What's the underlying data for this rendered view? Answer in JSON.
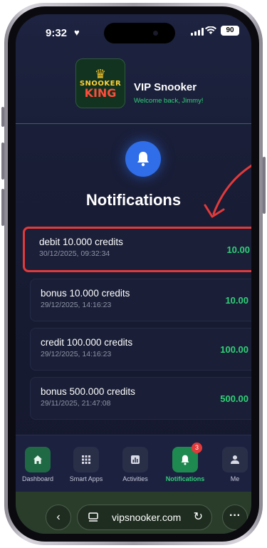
{
  "status": {
    "time": "9:32",
    "battery": "90"
  },
  "header": {
    "app_name": "VIP Snooker",
    "welcome": "Welcome back, Jimmy!",
    "logo_line1": "SNOOKER",
    "logo_line2": "KING"
  },
  "page": {
    "title": "Notifications"
  },
  "notifications": [
    {
      "title": "debit 10.000 credits",
      "date": "30/12/2025, 09:32:34",
      "amount": "10.00",
      "highlighted": true
    },
    {
      "title": "bonus 10.000 credits",
      "date": "29/12/2025, 14:16:23",
      "amount": "10.00"
    },
    {
      "title": "credit 100.000 credits",
      "date": "29/12/2025, 14:16:23",
      "amount": "100.00"
    },
    {
      "title": "bonus 500.000 credits",
      "date": "29/11/2025, 21:47:08",
      "amount": "500.00"
    }
  ],
  "nav": {
    "items": [
      {
        "label": "Dashboard",
        "icon": "home-icon"
      },
      {
        "label": "Smart Apps",
        "icon": "grid-icon"
      },
      {
        "label": "Activities",
        "icon": "chart-icon"
      },
      {
        "label": "Notifications",
        "icon": "bell-icon",
        "active": true,
        "badge": "3"
      },
      {
        "label": "Me",
        "icon": "person-icon"
      }
    ]
  },
  "browser": {
    "url": "vipsnooker.com"
  },
  "colors": {
    "accent_green": "#2fd177",
    "highlight_red": "#e23a3a",
    "bell_blue": "#2f6ee8"
  }
}
